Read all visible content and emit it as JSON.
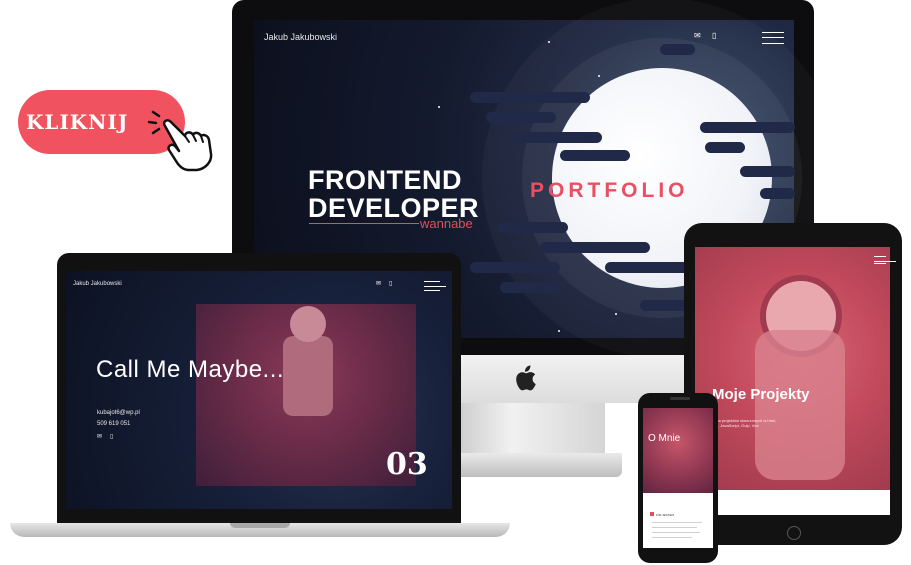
{
  "cta": {
    "label": "KLIKNIJ"
  },
  "imac": {
    "author": "Jakub Jakubowski",
    "headline_line1": "FRONTEND",
    "headline_line2": "DEVELOPER",
    "headline_sub": "wannabe",
    "portfolio": "PORTFOLIO"
  },
  "laptop": {
    "author": "Jakub Jakubowski",
    "headline": "Call Me Maybe...",
    "email": "kubajot6@wp.pl",
    "phone": "509 619 051",
    "slide_number": "03"
  },
  "tablet": {
    "section_title": "Moje Projekty",
    "caption": "Kilka projektów stworzonych w html, css, JavaScript, Gulp, Vue"
  },
  "phone": {
    "section_title": "O Mnie",
    "subheading": "KIM JESTEM"
  },
  "colors": {
    "accent": "#f0535f",
    "navy": "#141a2e"
  }
}
